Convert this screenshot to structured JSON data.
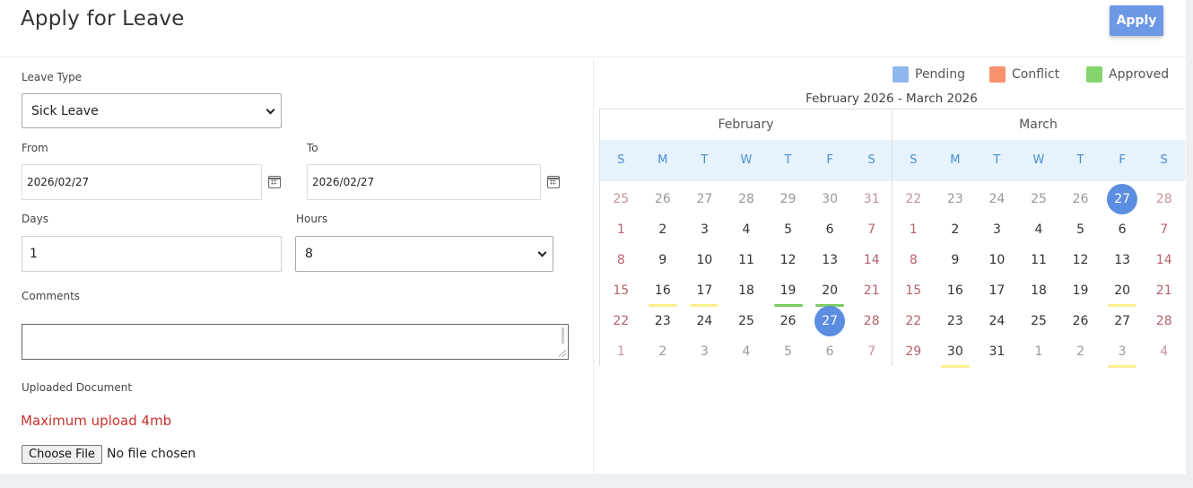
{
  "header": {
    "title": "Apply for Leave",
    "apply_label": "Apply"
  },
  "form": {
    "leave_type": {
      "label": "Leave Type",
      "value": "Sick Leave"
    },
    "from": {
      "label": "From",
      "value": "2026/02/27"
    },
    "to": {
      "label": "To",
      "value": "2026/02/27"
    },
    "days": {
      "label": "Days",
      "value": "1"
    },
    "hours": {
      "label": "Hours",
      "value": "8"
    },
    "comments": {
      "label": "Comments",
      "value": ""
    },
    "upload": {
      "label": "Uploaded Document",
      "note": "Maximum upload 4mb",
      "button_label": "Choose File",
      "status": "No file chosen"
    }
  },
  "legend": [
    {
      "label": "Pending",
      "color": "#8fb6ee"
    },
    {
      "label": "Conflict",
      "color": "#f7926c"
    },
    {
      "label": "Approved",
      "color": "#83d56c"
    }
  ],
  "calendar": {
    "range_title": "February 2026 - March 2026",
    "weekdays": [
      "S",
      "M",
      "T",
      "W",
      "T",
      "F",
      "S"
    ],
    "status_colors": {
      "pending": "#fbee8e",
      "approved": "#7ccb62"
    },
    "months": [
      {
        "name": "February",
        "weeks": [
          [
            {
              "d": "25",
              "m": true
            },
            {
              "d": "26",
              "m": true
            },
            {
              "d": "27",
              "m": true
            },
            {
              "d": "28",
              "m": true
            },
            {
              "d": "29",
              "m": true
            },
            {
              "d": "30",
              "m": true
            },
            {
              "d": "31",
              "m": true
            }
          ],
          [
            {
              "d": "1"
            },
            {
              "d": "2"
            },
            {
              "d": "3"
            },
            {
              "d": "4"
            },
            {
              "d": "5"
            },
            {
              "d": "6"
            },
            {
              "d": "7"
            }
          ],
          [
            {
              "d": "8"
            },
            {
              "d": "9"
            },
            {
              "d": "10"
            },
            {
              "d": "11"
            },
            {
              "d": "12"
            },
            {
              "d": "13"
            },
            {
              "d": "14"
            }
          ],
          [
            {
              "d": "15"
            },
            {
              "d": "16",
              "s": "pending"
            },
            {
              "d": "17",
              "s": "pending"
            },
            {
              "d": "18"
            },
            {
              "d": "19",
              "s": "approved"
            },
            {
              "d": "20",
              "s": "approved"
            },
            {
              "d": "21"
            }
          ],
          [
            {
              "d": "22"
            },
            {
              "d": "23"
            },
            {
              "d": "24"
            },
            {
              "d": "25"
            },
            {
              "d": "26"
            },
            {
              "d": "27",
              "sel": true
            },
            {
              "d": "28"
            }
          ],
          [
            {
              "d": "1",
              "m": true
            },
            {
              "d": "2",
              "m": true
            },
            {
              "d": "3",
              "m": true
            },
            {
              "d": "4",
              "m": true
            },
            {
              "d": "5",
              "m": true
            },
            {
              "d": "6",
              "m": true
            },
            {
              "d": "7",
              "m": true
            }
          ]
        ]
      },
      {
        "name": "March",
        "weeks": [
          [
            {
              "d": "22",
              "m": true
            },
            {
              "d": "23",
              "m": true
            },
            {
              "d": "24",
              "m": true
            },
            {
              "d": "25",
              "m": true
            },
            {
              "d": "26",
              "m": true
            },
            {
              "d": "27",
              "m": true,
              "sel": true
            },
            {
              "d": "28",
              "m": true
            }
          ],
          [
            {
              "d": "1"
            },
            {
              "d": "2"
            },
            {
              "d": "3"
            },
            {
              "d": "4"
            },
            {
              "d": "5"
            },
            {
              "d": "6"
            },
            {
              "d": "7"
            }
          ],
          [
            {
              "d": "8"
            },
            {
              "d": "9"
            },
            {
              "d": "10"
            },
            {
              "d": "11"
            },
            {
              "d": "12"
            },
            {
              "d": "13"
            },
            {
              "d": "14"
            }
          ],
          [
            {
              "d": "15"
            },
            {
              "d": "16"
            },
            {
              "d": "17"
            },
            {
              "d": "18"
            },
            {
              "d": "19"
            },
            {
              "d": "20",
              "s": "pending"
            },
            {
              "d": "21"
            }
          ],
          [
            {
              "d": "22"
            },
            {
              "d": "23"
            },
            {
              "d": "24"
            },
            {
              "d": "25"
            },
            {
              "d": "26"
            },
            {
              "d": "27"
            },
            {
              "d": "28"
            }
          ],
          [
            {
              "d": "29"
            },
            {
              "d": "30",
              "s": "pending"
            },
            {
              "d": "31"
            },
            {
              "d": "1",
              "m": true
            },
            {
              "d": "2",
              "m": true
            },
            {
              "d": "3",
              "m": true,
              "s": "pending"
            },
            {
              "d": "4",
              "m": true
            }
          ]
        ]
      }
    ]
  }
}
